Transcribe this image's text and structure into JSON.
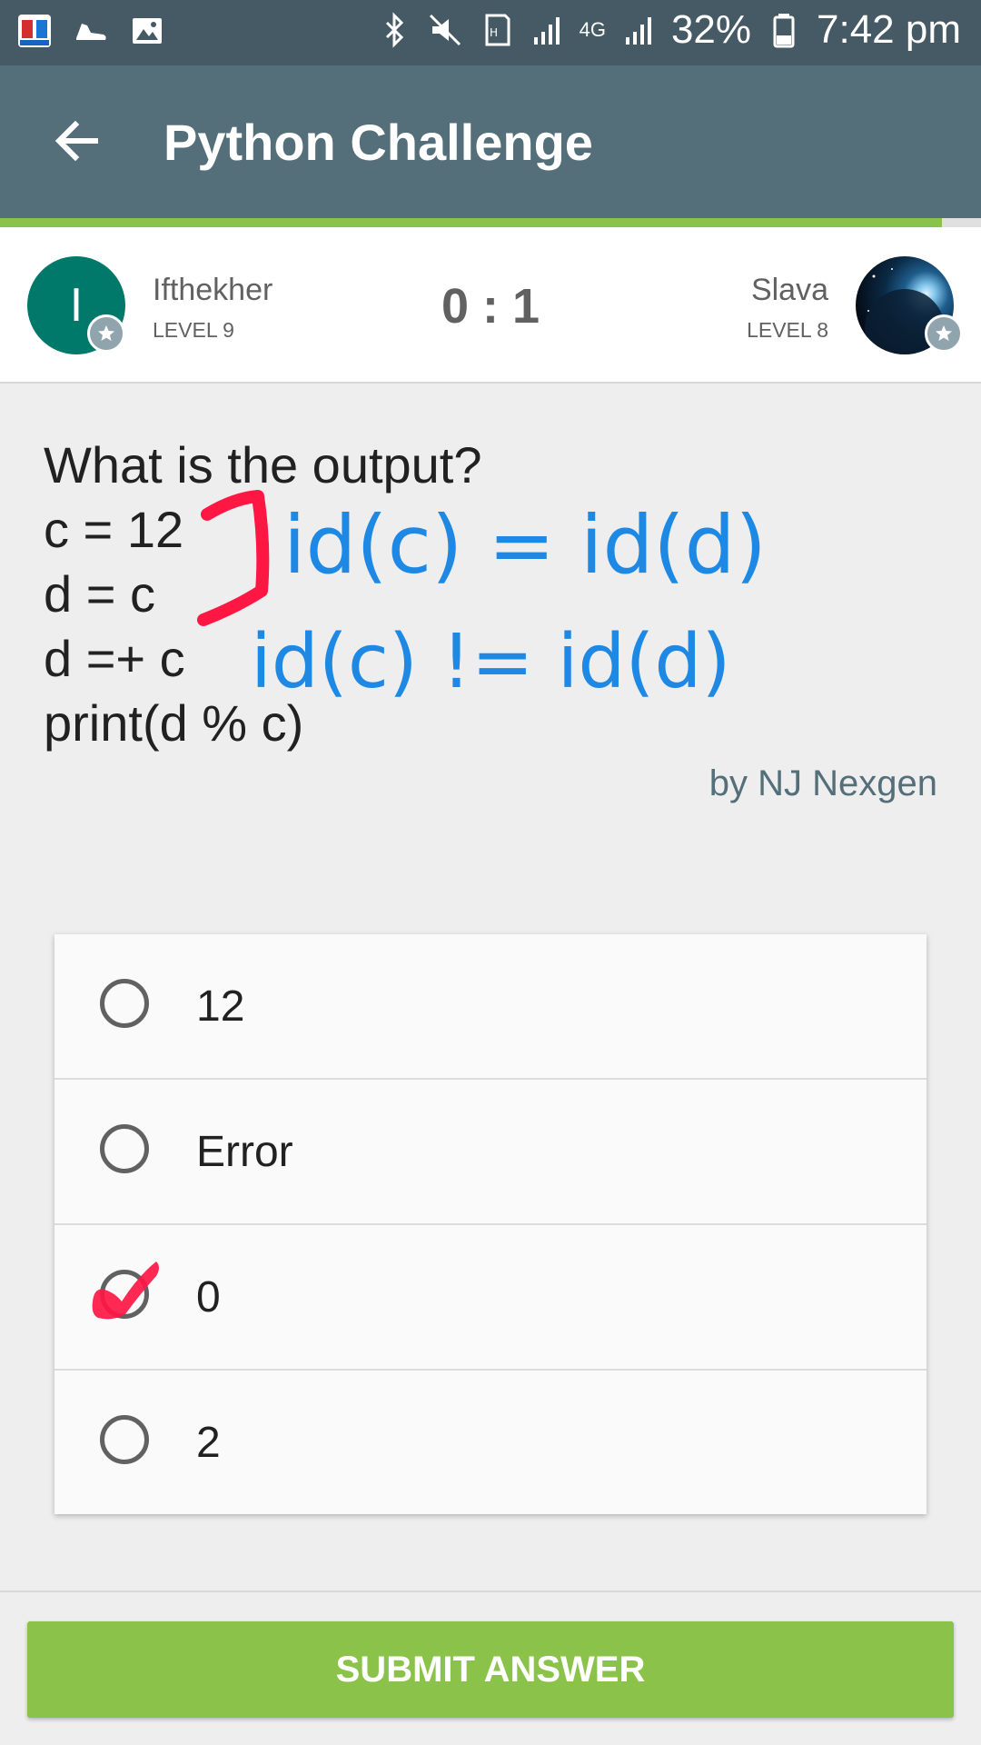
{
  "status_bar": {
    "battery": "32%",
    "time": "7:42 pm",
    "network": "4G",
    "icons": [
      "app-icon",
      "shoe-icon",
      "image-icon",
      "bluetooth-icon",
      "mute-icon",
      "hd-icon",
      "signal-icon",
      "signal-icon",
      "battery-icon"
    ]
  },
  "app_bar": {
    "title": "Python Challenge"
  },
  "progress": {
    "fraction": 0.96
  },
  "players": {
    "left": {
      "name": "Ifthekher",
      "level": "LEVEL 9",
      "initial": "I"
    },
    "right": {
      "name": "Slava",
      "level": "LEVEL 8"
    },
    "score": "0 : 1"
  },
  "question": {
    "lines": [
      "What is the output?",
      "c = 12",
      "d = c",
      "d =+ c",
      "print(d % c)"
    ],
    "author": "by NJ Nexgen"
  },
  "annotations": {
    "line1": "id(c) = id(d)",
    "line2": "id(c) != id(d)",
    "color_blue": "#1e88e5",
    "color_pink": "#ff1744"
  },
  "options": [
    {
      "label": "12"
    },
    {
      "label": "Error"
    },
    {
      "label": "0"
    },
    {
      "label": "2"
    }
  ],
  "submit": {
    "label": "SUBMIT ANSWER"
  },
  "colors": {
    "appbar": "#546e7a",
    "statusbar": "#455a64",
    "accent": "#8bc34a",
    "avatar": "#00796b"
  }
}
